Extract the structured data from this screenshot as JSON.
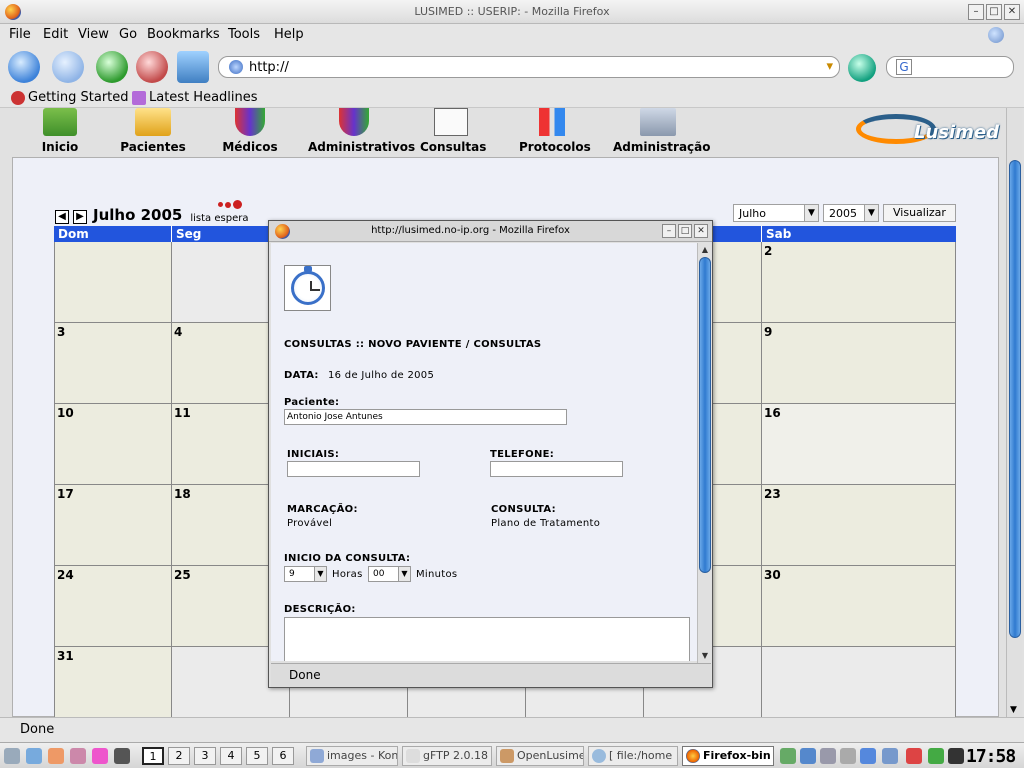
{
  "window": {
    "title": "LUSIMED :: USERIP:                    - Mozilla Firefox"
  },
  "menu": [
    "File",
    "Edit",
    "View",
    "Go",
    "Bookmarks",
    "Tools",
    "Help"
  ],
  "toolbar": {
    "url": "http://"
  },
  "bookmarks": [
    "Getting Started",
    "Latest Headlines"
  ],
  "app_nav": [
    "Inicio",
    "Pacientes",
    "Médicos",
    "Administrativos",
    "Consultas",
    "Protocolos",
    "Administração"
  ],
  "logo_text": "Lusimed",
  "calendar": {
    "title": "Julho 2005",
    "waitlist": "lista espera",
    "month_select": "Julho",
    "year_select": "2005",
    "view_button": "Visualizar",
    "weekdays": [
      "Dom",
      "Seg",
      "",
      "",
      "",
      "",
      "Sab"
    ],
    "rows": [
      [
        "",
        "",
        "",
        "",
        "",
        "",
        "2"
      ],
      [
        "3",
        "4",
        "",
        "",
        "",
        "",
        "9"
      ],
      [
        "10",
        "11",
        "",
        "",
        "",
        "",
        "16"
      ],
      [
        "17",
        "18",
        "",
        "",
        "",
        "",
        "23"
      ],
      [
        "24",
        "25",
        "",
        "",
        "",
        "",
        "30"
      ],
      [
        "31",
        "",
        "",
        "",
        "",
        "",
        ""
      ]
    ]
  },
  "popup": {
    "title": "http://lusimed.no-ip.org - Mozilla Firefox",
    "heading": "CONSULTAS :: NOVO PAVIENTE / CONSULTAS",
    "date_label": "DATA:",
    "date_value": "16 de Julho de 2005",
    "patient_label": "Paciente:",
    "patient_value": "Antonio Jose Antunes",
    "initials_label": "INICIAIS:",
    "phone_label": "TELEFONE:",
    "booking_label": "MARCAÇÃO:",
    "booking_value": "Provável",
    "consult_label": "CONSULTA:",
    "consult_value": "Plano de Tratamento",
    "start_label": "INICIO DA CONSULTA:",
    "hour_value": "9",
    "hours_label": "Horas",
    "minute_value": "00",
    "minutes_label": "Minutos",
    "description_label": "DESCRIÇÃO:",
    "status": "Done"
  },
  "status": "Done",
  "taskbar": {
    "desktops": [
      "1",
      "2",
      "3",
      "4",
      "5",
      "6"
    ],
    "tasks": [
      "images - Kon",
      "gFTP 2.0.18",
      "OpenLusime",
      "[   file:/home",
      "Firefox-bin"
    ],
    "clock": "17:58"
  }
}
